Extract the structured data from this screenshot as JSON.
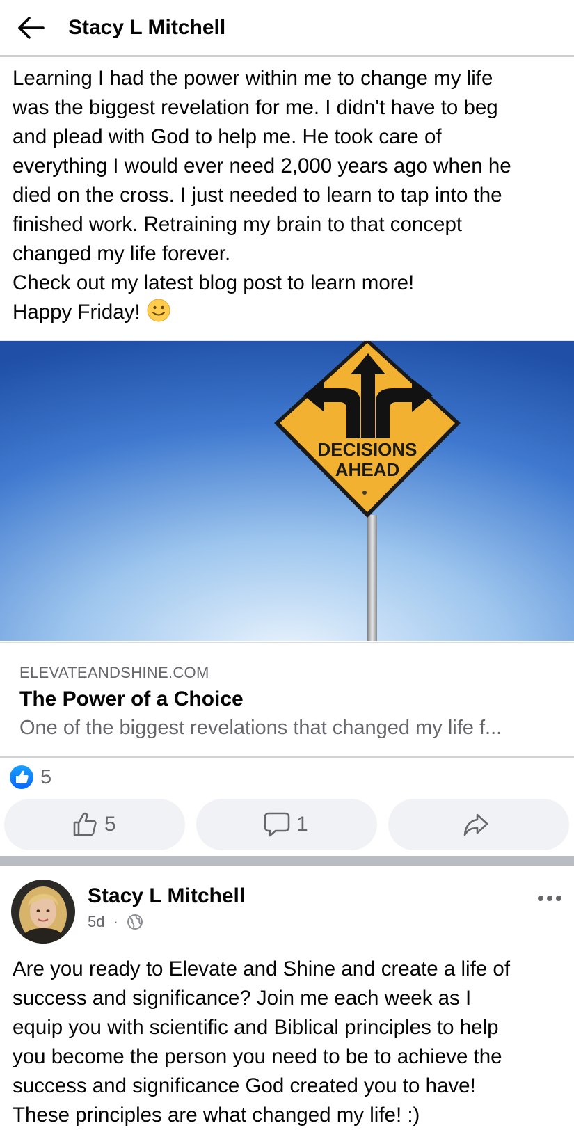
{
  "header": {
    "title": "Stacy L Mitchell",
    "back_icon": "arrow-left-icon"
  },
  "post": {
    "text_lines": [
      "Learning I had the power within me to change my life",
      "was the biggest revelation for me. I didn't have to beg",
      "and plead with God to help me. He took care of",
      "everything I would ever need 2,000 years ago when he",
      "died on the cross. I just needed to learn to tap into the",
      "finished work. Retraining my brain to that concept",
      "changed my life forever.",
      "Check out my latest blog post to learn more!",
      "Happy Friday!"
    ],
    "emoji": "slightly-smiling-face",
    "link": {
      "image_sign_line1": "DECISIONS",
      "image_sign_line2": "AHEAD",
      "domain": "ELEVATEANDSHINE.COM",
      "title": "The Power of a Choice",
      "description": "One of the biggest revelations that changed my life f..."
    },
    "reaction_count": "5",
    "actions": {
      "like_count": "5",
      "comment_count": "1"
    }
  },
  "next_post": {
    "author": "Stacy L Mitchell",
    "time": "5d",
    "separator": "·",
    "privacy_icon": "globe-icon",
    "text_lines": [
      "Are you ready to Elevate and Shine and create a life of",
      "success and significance? Join me each week as I",
      "equip you with scientific and Biblical principles to help",
      "you become the person you need to be to achieve the",
      "success and significance God created you to have!",
      "These principles are what changed my life! :)"
    ]
  },
  "colors": {
    "accent_blue": "#0866ff",
    "muted_text": "#65676b",
    "sign_yellow": "#f3b132",
    "button_bg": "#f0f2f5"
  }
}
